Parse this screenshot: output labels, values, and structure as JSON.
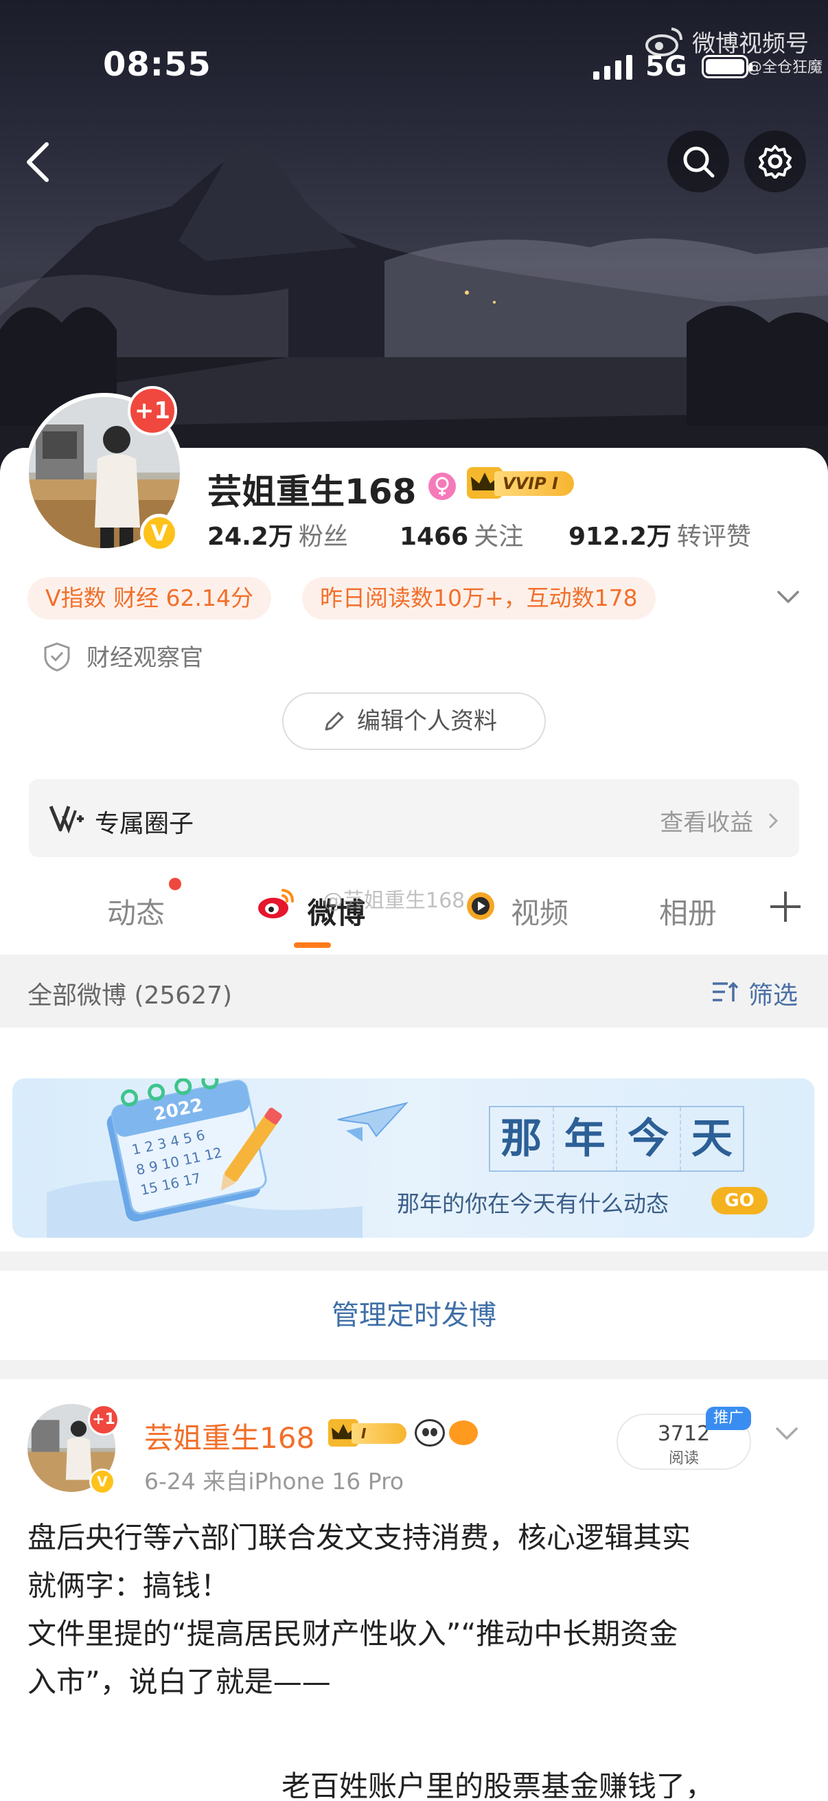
{
  "status_bar": {
    "time": "08:55",
    "network": "5G"
  },
  "watermark": {
    "brand": "微博视频号",
    "handle": "@全仓狂魔",
    "overlay_handle": "@芸姐重生168"
  },
  "profile": {
    "name": "芸姐重生168",
    "avatar_badge": "+1",
    "verified_mark": "V",
    "vip_label": "VVIP I",
    "stats": [
      {
        "value": "24.2万",
        "label": "粉丝"
      },
      {
        "value": "1466",
        "label": "关注"
      },
      {
        "value": "912.2万",
        "label": "转评赞"
      }
    ],
    "pills": [
      "V指数 财经 62.14分",
      "昨日阅读数10万+，互动数178"
    ],
    "certification": "财经观察官",
    "edit_button": "编辑个人资料",
    "circle": {
      "title": "专属圈子",
      "right_link": "查看收益"
    }
  },
  "tabs": [
    {
      "label": "动态"
    },
    {
      "label": "微博"
    },
    {
      "label": "视频"
    },
    {
      "label": "相册"
    }
  ],
  "filter": {
    "count_text": "全部微博 (25627)",
    "button": "筛选"
  },
  "banner": {
    "calendar_year": "2022",
    "title_chars": [
      "那",
      "年",
      "今",
      "天"
    ],
    "subtitle": "那年的你在今天有什么动态",
    "go": "GO"
  },
  "manage_link": "管理定时发博",
  "post": {
    "author": "芸姐重生168",
    "avatar_badge": "+1",
    "verified_mark": "V",
    "vip_label": "I",
    "meta": "6-24  来自iPhone 16 Pro",
    "read_count": "3712",
    "read_label": "阅读",
    "promo_label": "推广",
    "lines": [
      "盘后央行等六部门联合发文支持消费，核心逻辑其实",
      "就俩字：搞钱！",
      "文件里提的“提高居民财产性收入”“推动中长期资金",
      "入市”，说白了就是——"
    ],
    "cut_line": "老百姓账户里的股票基金赚钱了，"
  },
  "colors": {
    "accent_orange": "#f26f2a",
    "link_blue": "#3f6fa7",
    "badge_red": "#f0483e",
    "vip_gold": "#f5b72b"
  }
}
